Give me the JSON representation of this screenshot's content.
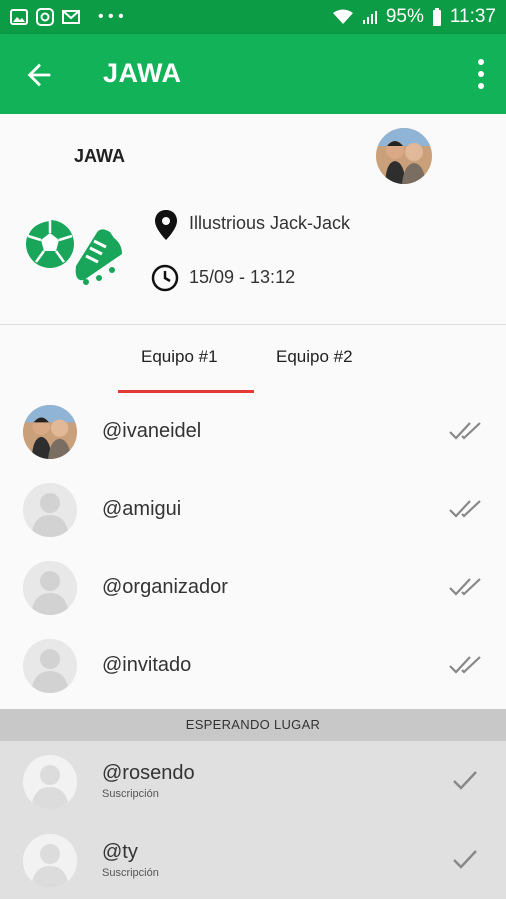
{
  "status_bar": {
    "battery": "95%",
    "time": "11:37",
    "icons": [
      "image-icon",
      "instagram-icon",
      "gmail-icon",
      "more-dots-icon",
      "wifi-icon",
      "signal-icon",
      "battery-icon"
    ]
  },
  "app_bar": {
    "title": "JAWA"
  },
  "event": {
    "name": "JAWA",
    "location": "Illustrious Jack-Jack",
    "datetime": "15/09 - 13:12"
  },
  "tabs": [
    {
      "label": "Equipo #1",
      "selected": true
    },
    {
      "label": "Equipo #2",
      "selected": false
    }
  ],
  "players": [
    {
      "handle": "@ivaneidel",
      "avatar": "photo",
      "status": "double-check"
    },
    {
      "handle": "@amigui",
      "avatar": "placeholder",
      "status": "double-check"
    },
    {
      "handle": "@organizador",
      "avatar": "placeholder",
      "status": "double-check"
    },
    {
      "handle": "@invitado",
      "avatar": "placeholder",
      "status": "double-check"
    }
  ],
  "waiting_section": {
    "label": "ESPERANDO LUGAR"
  },
  "waiting": [
    {
      "handle": "@rosendo",
      "subtitle": "Suscripción",
      "status": "check"
    },
    {
      "handle": "@ty",
      "subtitle": "Suscripción",
      "status": "check"
    }
  ],
  "colors": {
    "status_bar": "#0c9c45",
    "app_bar": "#12b259",
    "tab_indicator": "#e53935",
    "sport_icon": "#19a55a",
    "waiting_bg": "#e0e0e0",
    "section_bg": "#c8c8c8"
  }
}
